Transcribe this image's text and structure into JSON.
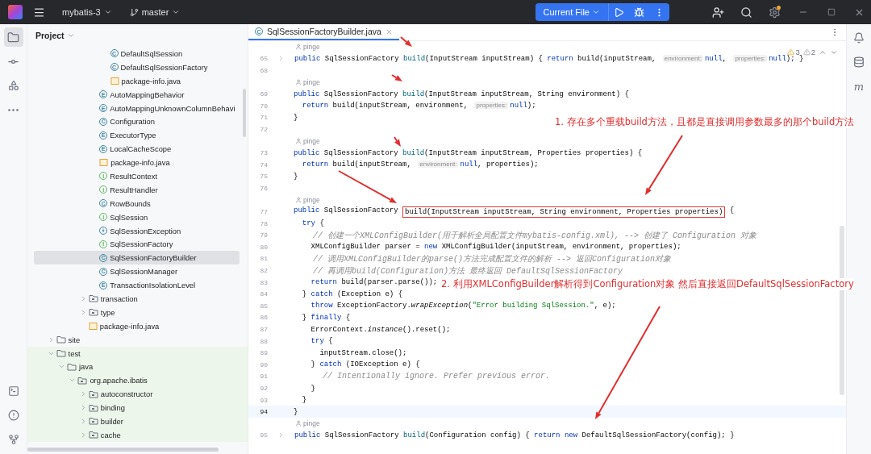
{
  "top_bar": {
    "project": "mybatis-3",
    "branch": "master",
    "run_config": "Current File"
  },
  "sidebar": {
    "title": "Project",
    "tree": [
      {
        "children": [
          {
            "children": [
              {
                "children": [
                  {
                    "children": [
                      {
                        "children": [
                          {
                            "label": "DefaultSqlSession",
                            "kind": "class",
                            "badge": "C",
                            "selected": false
                          },
                          {
                            "label": "DefaultSqlSessionFactory",
                            "kind": "class",
                            "badge": "C",
                            "selected": false
                          },
                          {
                            "label": "package-info.java",
                            "kind": "file",
                            "selected": false
                          }
                        ]
                      },
                      {
                        "label": "AutoMappingBehavior",
                        "kind": "enum",
                        "badge": "E",
                        "selected": false
                      },
                      {
                        "label": "AutoMappingUnknownColumnBehavi",
                        "kind": "enum",
                        "badge": "E",
                        "selected": false
                      },
                      {
                        "label": "Configuration",
                        "kind": "class",
                        "badge": "C",
                        "selected": false
                      },
                      {
                        "label": "ExecutorType",
                        "kind": "enum",
                        "badge": "E",
                        "selected": false
                      },
                      {
                        "label": "LocalCacheScope",
                        "kind": "enum",
                        "badge": "E",
                        "selected": false
                      },
                      {
                        "label": "package-info.java",
                        "kind": "file",
                        "selected": false
                      },
                      {
                        "label": "ResultContext",
                        "kind": "interface",
                        "badge": "I",
                        "selected": false
                      },
                      {
                        "label": "ResultHandler",
                        "kind": "interface",
                        "badge": "I",
                        "selected": false
                      },
                      {
                        "label": "RowBounds",
                        "kind": "class",
                        "badge": "C",
                        "selected": false
                      },
                      {
                        "label": "SqlSession",
                        "kind": "interface",
                        "badge": "I",
                        "selected": false
                      },
                      {
                        "label": "SqlSessionException",
                        "kind": "exception",
                        "selected": false
                      },
                      {
                        "label": "SqlSessionFactory",
                        "kind": "interface",
                        "badge": "I",
                        "selected": false
                      },
                      {
                        "label": "SqlSessionFactoryBuilder",
                        "kind": "class",
                        "badge": "C",
                        "selected": true
                      },
                      {
                        "label": "SqlSessionManager",
                        "kind": "class",
                        "badge": "C",
                        "selected": false
                      },
                      {
                        "label": "TransactionIsolationLevel",
                        "kind": "enum",
                        "badge": "E",
                        "selected": false
                      }
                    ]
                  },
                  {
                    "label": "transaction",
                    "kind": "package",
                    "expanded": false,
                    "selected": false
                  },
                  {
                    "label": "type",
                    "kind": "package",
                    "expanded": false,
                    "selected": false
                  },
                  {
                    "label": "package-info.java",
                    "kind": "file",
                    "selected": false
                  }
                ]
              }
            ]
          }
        ]
      },
      {
        "label": "site",
        "kind": "folder",
        "expanded": false,
        "selected": false
      },
      {
        "label": "test",
        "kind": "folder",
        "expanded": true,
        "test_scope": true,
        "selected": false,
        "children": [
          {
            "label": "java",
            "kind": "folder",
            "expanded": true,
            "selected": false,
            "children": [
              {
                "label": "org.apache.ibatis",
                "kind": "package",
                "expanded": true,
                "selected": false,
                "children": [
                  {
                    "label": "autoconstructor",
                    "kind": "package",
                    "expanded": false,
                    "selected": false
                  },
                  {
                    "label": "binding",
                    "kind": "package",
                    "expanded": false,
                    "selected": false
                  },
                  {
                    "label": "builder",
                    "kind": "package",
                    "expanded": false,
                    "selected": false
                  },
                  {
                    "label": "cache",
                    "kind": "package",
                    "expanded": false,
                    "selected": false
                  }
                ]
              }
            ]
          }
        ]
      }
    ]
  },
  "editor": {
    "tab": {
      "label": "SqlSessionFactoryBuilder.java",
      "badge": "C",
      "selected": true
    },
    "inspections": {
      "warnings": "3",
      "weak_warnings": "2"
    },
    "rows": [
      {
        "kind": "author",
        "text": "pinge"
      },
      {
        "kind": "code",
        "number": "65",
        "folded": true,
        "current": false,
        "segments": [
          {
            "kind": "kw",
            "text": "public "
          },
          {
            "kind": "plain",
            "text": "SqlSessionFactory "
          },
          {
            "kind": "decl",
            "text": "build"
          },
          {
            "kind": "plain",
            "text": "(InputStream inputStream) { "
          },
          {
            "kind": "kw",
            "text": "return "
          },
          {
            "kind": "plain",
            "text": "build(inputStream, "
          },
          {
            "kind": "hint",
            "text": "environment:"
          },
          {
            "kind": "kw",
            "text": "null"
          },
          {
            "kind": "plain",
            "text": ", "
          },
          {
            "kind": "hint",
            "text": "properties:"
          },
          {
            "kind": "kw",
            "text": "null"
          },
          {
            "kind": "plain",
            "text": "); }"
          }
        ]
      },
      {
        "kind": "code",
        "number": "68",
        "folded": false,
        "current": false,
        "segments": []
      },
      {
        "kind": "author",
        "text": "pinge"
      },
      {
        "kind": "code",
        "number": "69",
        "folded": false,
        "current": false,
        "segments": [
          {
            "kind": "kw",
            "text": "public "
          },
          {
            "kind": "plain",
            "text": "SqlSessionFactory "
          },
          {
            "kind": "decl",
            "text": "build"
          },
          {
            "kind": "plain",
            "text": "(InputStream inputStream, String environment) {"
          }
        ]
      },
      {
        "kind": "code",
        "number": "70",
        "folded": false,
        "current": false,
        "segments": [
          {
            "kind": "kw",
            "text": "  return "
          },
          {
            "kind": "plain",
            "text": "build(inputStream, environment, "
          },
          {
            "kind": "hint",
            "text": "properties:"
          },
          {
            "kind": "kw",
            "text": "null"
          },
          {
            "kind": "plain",
            "text": ");"
          }
        ]
      },
      {
        "kind": "code",
        "number": "71",
        "folded": false,
        "current": false,
        "segments": [
          {
            "kind": "plain",
            "text": "}"
          }
        ]
      },
      {
        "kind": "code",
        "number": "72",
        "folded": false,
        "current": false,
        "segments": []
      },
      {
        "kind": "author",
        "text": "pinge"
      },
      {
        "kind": "code",
        "number": "73",
        "folded": false,
        "current": false,
        "segments": [
          {
            "kind": "kw",
            "text": "public "
          },
          {
            "kind": "plain",
            "text": "SqlSessionFactory "
          },
          {
            "kind": "decl",
            "text": "build"
          },
          {
            "kind": "plain",
            "text": "(InputStream inputStream, Properties properties) {"
          }
        ]
      },
      {
        "kind": "code",
        "number": "74",
        "folded": false,
        "current": false,
        "segments": [
          {
            "kind": "kw",
            "text": "  return "
          },
          {
            "kind": "plain",
            "text": "build(inputStream, "
          },
          {
            "kind": "hint",
            "text": "environment:"
          },
          {
            "kind": "kw",
            "text": "null"
          },
          {
            "kind": "plain",
            "text": ", properties);"
          }
        ]
      },
      {
        "kind": "code",
        "number": "75",
        "folded": false,
        "current": false,
        "segments": [
          {
            "kind": "plain",
            "text": "}"
          }
        ]
      },
      {
        "kind": "code",
        "number": "76",
        "folded": false,
        "current": false,
        "segments": []
      },
      {
        "kind": "author",
        "text": "pinge"
      },
      {
        "kind": "code",
        "number": "77",
        "folded": false,
        "current": false,
        "segments": [
          {
            "kind": "kw",
            "text": "public "
          },
          {
            "kind": "plain",
            "text": "SqlSessionFactory "
          },
          {
            "kind": "boxed",
            "text": "build(InputStream inputStream, String environment, Properties properties)"
          },
          {
            "kind": "plain",
            "text": " {"
          }
        ]
      },
      {
        "kind": "code",
        "number": "78",
        "folded": false,
        "current": false,
        "segments": [
          {
            "kind": "kw",
            "text": "  try"
          },
          {
            "kind": "plain",
            "text": " {"
          }
        ]
      },
      {
        "kind": "code",
        "number": "79",
        "folded": false,
        "current": false,
        "segments": [
          {
            "kind": "comment",
            "text": "    // 创建一个XMLConfigBuilder(用于解析全局配置文件mybatis-config.xml), --> 创建了 Configuration 对象"
          }
        ]
      },
      {
        "kind": "code",
        "number": "80",
        "folded": false,
        "current": false,
        "segments": [
          {
            "kind": "plain",
            "text": "    XMLConfigBuilder parser = "
          },
          {
            "kind": "kw",
            "text": "new"
          },
          {
            "kind": "plain",
            "text": " XMLConfigBuilder(inputStream, environment, properties);"
          }
        ]
      },
      {
        "kind": "code",
        "number": "81",
        "folded": false,
        "current": false,
        "segments": [
          {
            "kind": "comment",
            "text": "    // 调用XMLConfigBuilder的parse()方法完成配置文件的解析 --> 返回Configuration对象"
          }
        ]
      },
      {
        "kind": "code",
        "number": "82",
        "folded": false,
        "current": false,
        "segments": [
          {
            "kind": "comment",
            "text": "    // 再调用build(Configuration)方法 最终返回 DefaultSqlSessionFactory"
          }
        ]
      },
      {
        "kind": "code",
        "number": "83",
        "folded": false,
        "current": false,
        "segments": [
          {
            "kind": "kw",
            "text": "    return"
          },
          {
            "kind": "plain",
            "text": " build(parser.parse());"
          }
        ]
      },
      {
        "kind": "code",
        "number": "84",
        "folded": false,
        "current": false,
        "segments": [
          {
            "kind": "plain",
            "text": "  } "
          },
          {
            "kind": "kw",
            "text": "catch"
          },
          {
            "kind": "plain",
            "text": " (Exception e) {"
          }
        ]
      },
      {
        "kind": "code",
        "number": "85",
        "folded": false,
        "current": false,
        "segments": [
          {
            "kind": "kw",
            "text": "    throw"
          },
          {
            "kind": "plain",
            "text": " ExceptionFactory."
          },
          {
            "kind": "italic",
            "text": "wrapException"
          },
          {
            "kind": "plain",
            "text": "("
          },
          {
            "kind": "string",
            "text": "\"Error building SqlSession.\""
          },
          {
            "kind": "plain",
            "text": ", e);"
          }
        ]
      },
      {
        "kind": "code",
        "number": "86",
        "folded": false,
        "current": false,
        "segments": [
          {
            "kind": "plain",
            "text": "  } "
          },
          {
            "kind": "kw",
            "text": "finally"
          },
          {
            "kind": "plain",
            "text": " {"
          }
        ]
      },
      {
        "kind": "code",
        "number": "87",
        "folded": false,
        "current": false,
        "segments": [
          {
            "kind": "plain",
            "text": "    ErrorContext."
          },
          {
            "kind": "italic",
            "text": "instance"
          },
          {
            "kind": "plain",
            "text": "().reset();"
          }
        ]
      },
      {
        "kind": "code",
        "number": "88",
        "folded": false,
        "current": false,
        "segments": [
          {
            "kind": "kw",
            "text": "    try"
          },
          {
            "kind": "plain",
            "text": " {"
          }
        ]
      },
      {
        "kind": "code",
        "number": "89",
        "folded": false,
        "current": false,
        "segments": [
          {
            "kind": "plain",
            "text": "      inputStream.close();"
          }
        ]
      },
      {
        "kind": "code",
        "number": "90",
        "folded": false,
        "current": false,
        "segments": [
          {
            "kind": "plain",
            "text": "    } "
          },
          {
            "kind": "kw",
            "text": "catch"
          },
          {
            "kind": "plain",
            "text": " (IOException e) {"
          }
        ]
      },
      {
        "kind": "code",
        "number": "91",
        "folded": false,
        "current": false,
        "segments": [
          {
            "kind": "comment",
            "text": "      // Intentionally ignore. Prefer previous error."
          }
        ]
      },
      {
        "kind": "code",
        "number": "92",
        "folded": false,
        "current": false,
        "segments": [
          {
            "kind": "plain",
            "text": "    }"
          }
        ]
      },
      {
        "kind": "code",
        "number": "93",
        "folded": false,
        "current": false,
        "segments": [
          {
            "kind": "plain",
            "text": "  }"
          }
        ]
      },
      {
        "kind": "code",
        "number": "94",
        "folded": false,
        "current": true,
        "segments": [
          {
            "kind": "plain",
            "text": "}"
          }
        ]
      },
      {
        "kind": "author",
        "text": "pinge"
      },
      {
        "kind": "code",
        "number": "95",
        "folded": true,
        "current": false,
        "segments": [
          {
            "kind": "kw",
            "text": "public "
          },
          {
            "kind": "plain",
            "text": "SqlSessionFactory "
          },
          {
            "kind": "decl",
            "text": "build"
          },
          {
            "kind": "plain",
            "text": "(Configuration config) { "
          },
          {
            "kind": "kw",
            "text": "return new "
          },
          {
            "kind": "plain",
            "text": "DefaultSqlSessionFactory(config); }"
          }
        ]
      }
    ]
  },
  "annotations": [
    {
      "text": "1. 存在多个重载build方法，且都是直接调用参数最多的那个build方法"
    },
    {
      "text": "2. 利用XMLConfigBuilder解析得到Configuration对象 然后直接返回DefaultSqlSessionFactory"
    }
  ],
  "right_strip": {
    "maven": "m"
  }
}
